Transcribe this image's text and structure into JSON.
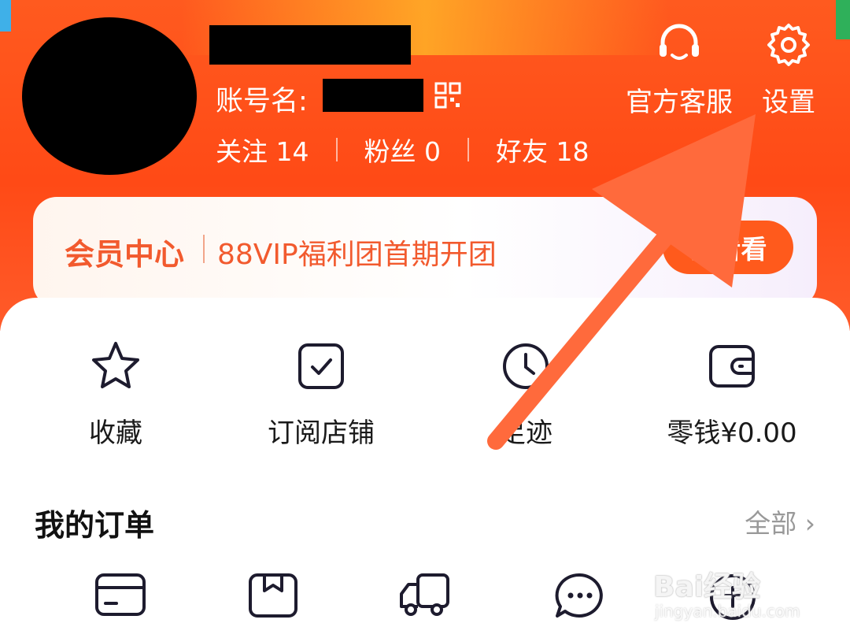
{
  "profile": {
    "account_label": "账号名:",
    "stats": [
      {
        "label": "关注",
        "value": "14"
      },
      {
        "label": "粉丝",
        "value": "0"
      },
      {
        "label": "好友",
        "value": "18"
      }
    ]
  },
  "header_actions": {
    "service_label": "官方客服",
    "settings_label": "设置"
  },
  "vip": {
    "title": "会员中心",
    "promo": "88VIP福利团首期开团",
    "button": "去看看"
  },
  "quick_links": [
    {
      "label": "收藏",
      "icon": "star-icon"
    },
    {
      "label": "订阅店铺",
      "icon": "checkbox-icon"
    },
    {
      "label": "足迹",
      "icon": "clock-icon"
    },
    {
      "label": "零钱¥0.00",
      "icon": "wallet-icon"
    }
  ],
  "orders": {
    "title": "我的订单",
    "all": "全部",
    "icons": [
      "payment-card-icon",
      "package-icon",
      "truck-icon",
      "chat-bubble-icon",
      "refund-icon"
    ]
  },
  "watermark": {
    "main": "Bai经验",
    "sub": "jingyan.baidu.com"
  },
  "colors": {
    "brand": "#ff4f1a",
    "accent_text": "#f25a2e",
    "arrow": "#ff6a3c"
  }
}
